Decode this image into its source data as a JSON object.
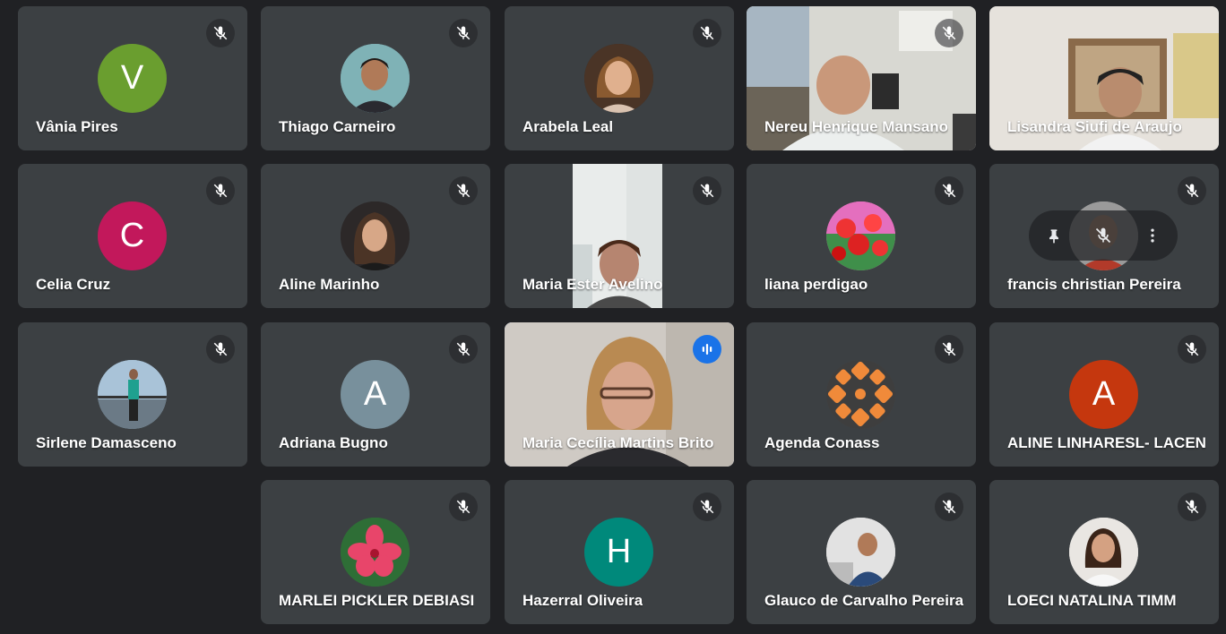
{
  "participants": [
    {
      "name": "Vânia Pires",
      "initial": "V",
      "color": "#6a9e2f"
    },
    {
      "name": "Thiago Carneiro"
    },
    {
      "name": "Arabela Leal"
    },
    {
      "name": "Nereu Henrique Mansano"
    },
    {
      "name": "Lisandra Siufi de Araujo"
    },
    {
      "name": "Celia Cruz",
      "initial": "C",
      "color": "#c2185b"
    },
    {
      "name": "Aline Marinho"
    },
    {
      "name": "Maria Ester Avelino"
    },
    {
      "name": "liana perdigao"
    },
    {
      "name": "francis christian Pereira"
    },
    {
      "name": "Sirlene Damasceno"
    },
    {
      "name": "Adriana Bugno",
      "initial": "A",
      "color": "#78909c"
    },
    {
      "name": "Maria Cecília Martins Brito"
    },
    {
      "name": "Agenda Conass"
    },
    {
      "name": "ALINE LINHARESL- LACEN",
      "initial": "A",
      "color": "#c5370e"
    },
    {
      "name": "MARLEI PICKLER DEBIASI"
    },
    {
      "name": "Hazerral Oliveira",
      "initial": "H",
      "color": "#00897b"
    },
    {
      "name": "Glauco de Carvalho Pereira"
    },
    {
      "name": "LOECI NATALINA TIMM"
    }
  ],
  "icons": {
    "muted": "mic-off-icon",
    "speaking": "audio-level-icon",
    "pin": "pin-icon",
    "more": "more-vert-icon"
  },
  "colors": {
    "background": "#202124",
    "tile": "#3c4043",
    "speaking_border": "#8ab4f8",
    "speaking_badge": "#1a73e8"
  }
}
